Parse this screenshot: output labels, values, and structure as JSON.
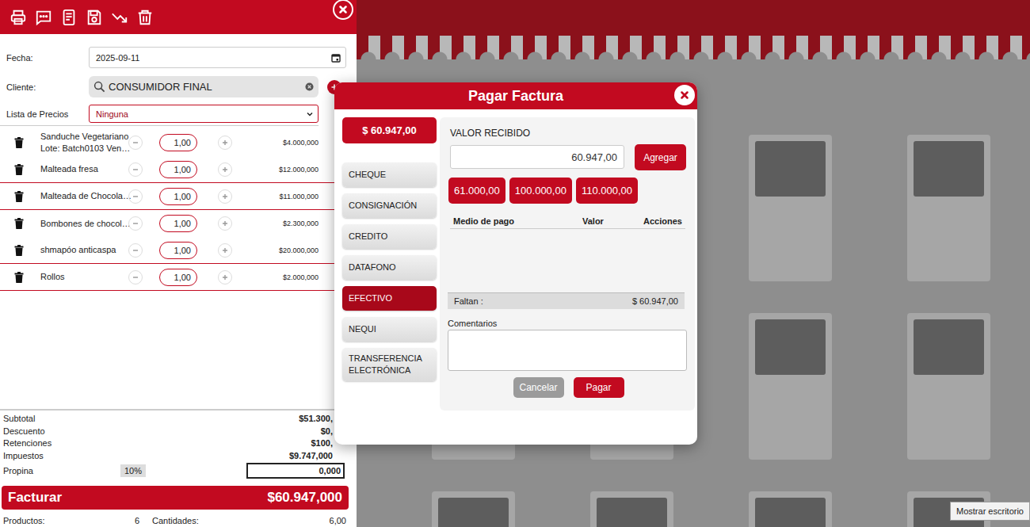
{
  "invoice": {
    "date": {
      "label": "Fecha:",
      "value": "2025-09-11"
    },
    "client": {
      "label": "Cliente:",
      "value": "CONSUMIDOR FINAL"
    },
    "price_list": {
      "label": "Lista de Precios",
      "value": "Ninguna"
    },
    "items": [
      {
        "name": "Sanduche Vegetariano",
        "detail": "Lote: Batch0103 Ven…",
        "quantity": "1,00",
        "price": "$4.000,000",
        "divider": false
      },
      {
        "name": "Malteada fresa",
        "quantity": "1,00",
        "price": "$12.000,000",
        "divider": true
      },
      {
        "name": "Malteada de Chocola…",
        "quantity": "1,00",
        "price": "$11.000,000",
        "divider": true
      },
      {
        "name": "Bombones de chocol…",
        "quantity": "1,00",
        "price": "$2.300,000",
        "divider": false
      },
      {
        "name": "shmapóo anticaspa",
        "quantity": "1,00",
        "price": "$20.000,000",
        "divider": true
      },
      {
        "name": "Rollos",
        "quantity": "1,00",
        "price": "$2.000,000",
        "divider": true
      }
    ],
    "totals": [
      {
        "label": "Subtotal",
        "value": "$51.300,"
      },
      {
        "label": "Descuento",
        "value": "$0,"
      },
      {
        "label": "Retenciones",
        "value": "$100,"
      },
      {
        "label": "Impuestos",
        "value": "$9.747,000"
      }
    ],
    "tip": {
      "label": "Propina",
      "percent": "10%",
      "value": "0,000"
    },
    "checkout": {
      "label": "Facturar",
      "total": "$60.947,000"
    },
    "summary": [
      {
        "label": "Productos:",
        "value": "6"
      },
      {
        "label": "Cantidades:",
        "value": "6,00"
      }
    ]
  },
  "dialog": {
    "title": "Pagar Factura",
    "amount": "$ 60.947,00",
    "methods": [
      {
        "label": "CHEQUE",
        "selected": false
      },
      {
        "label": "CONSIGNACIÓN",
        "selected": false
      },
      {
        "label": "CREDITO",
        "selected": false
      },
      {
        "label": "DATAFONO",
        "selected": false
      },
      {
        "label": "EFECTIVO",
        "selected": true
      },
      {
        "label": "NEQUI",
        "selected": false
      },
      {
        "label": "TRANSFERENCIA ELECTRÓNICA",
        "selected": false
      }
    ],
    "received": {
      "label": "VALOR RECIBIDO",
      "value": "60.947,00"
    },
    "add_button": "Agregar",
    "quick_amounts": [
      "61.000,00",
      "100.000,00",
      "110.000,00"
    ],
    "table": {
      "columns": [
        "Medio de pago",
        "Valor",
        "Acciones"
      ]
    },
    "remaining": {
      "label": "Faltan :",
      "value": "$ 60.947,00"
    },
    "comments": {
      "label": "Comentarios"
    },
    "buttons": [
      {
        "label": "Cancelar",
        "kind": "secondary"
      },
      {
        "label": "Pagar",
        "kind": "primary"
      }
    ]
  },
  "tooltip": "Mostrar escritorio"
}
